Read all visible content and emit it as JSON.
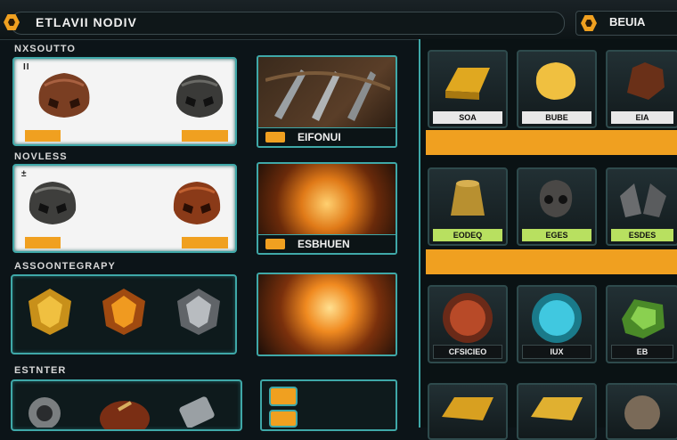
{
  "topbar": {
    "title": "ETLAVII NODIV",
    "sell_tab": "BEUIA"
  },
  "sections": {
    "s1": "NXSOUTTO",
    "s2": "NOVLESS",
    "s3": "ASSOONTEGRAPY",
    "s4": "ESTNTER"
  },
  "panels": {
    "p1": {
      "marker": "II",
      "left_icon": "brown-helmet-icon",
      "right_icon": "dark-helmet-icon"
    },
    "p2": {
      "marker": "±",
      "left_icon": "dark-helmet-icon",
      "right_icon": "red-helmet-icon"
    },
    "p3": {
      "icons": [
        "gold-crystal-icon",
        "fire-crystal-icon",
        "silver-crystal-icon"
      ]
    },
    "p4": {
      "icons": [
        "silver-orb-icon",
        "red-disc-icon",
        "steel-canister-icon"
      ]
    }
  },
  "artworks": {
    "a1": {
      "caption": "EIFONUI",
      "art": "blades-artwork"
    },
    "a2": {
      "caption": "ESBHUEN",
      "art": "fire-artwork"
    },
    "a3": {
      "art": "fire-artwork"
    }
  },
  "grid": {
    "row1": [
      {
        "label": "SOA",
        "icon": "gold-bar-icon"
      },
      {
        "label": "BUBE",
        "icon": "gold-nugget-icon"
      },
      {
        "label": "EIA",
        "icon": "leather-glove-icon"
      }
    ],
    "row2": [
      {
        "label": "EODEQ",
        "icon": "brass-pot-icon"
      },
      {
        "label": "EGES",
        "icon": "skull-icon"
      },
      {
        "label": "ESDES",
        "icon": "steel-armor-icon"
      }
    ],
    "row3": [
      {
        "label": "CFSICIEO",
        "icon": "red-gem-icon"
      },
      {
        "label": "IUX",
        "icon": "cyan-gem-icon"
      },
      {
        "label": "EB",
        "icon": "green-gem-icon"
      }
    ],
    "row4": [
      {
        "icon": "gold-ingot-icon"
      },
      {
        "icon": "gold-ingot-icon"
      },
      {
        "icon": "stone-orb-icon"
      }
    ]
  },
  "colors": {
    "accent": "#f0a020",
    "frame": "#3fa8a8",
    "background": "#0c1418"
  }
}
